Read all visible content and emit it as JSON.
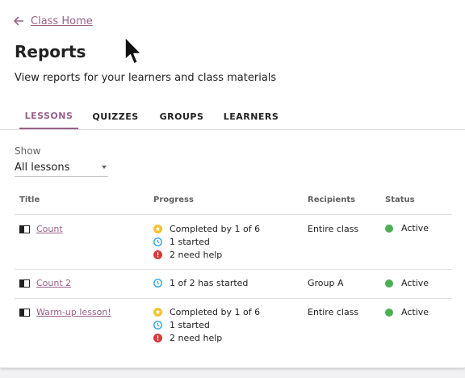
{
  "nav": {
    "back_label": "Class Home"
  },
  "header": {
    "title": "Reports",
    "subtitle": "View reports for your learners and class materials"
  },
  "tabs": [
    {
      "label": "LESSONS",
      "active": true
    },
    {
      "label": "QUIZZES",
      "active": false
    },
    {
      "label": "GROUPS",
      "active": false
    },
    {
      "label": "LEARNERS",
      "active": false
    }
  ],
  "filter": {
    "label": "Show",
    "selected": "All lessons"
  },
  "table": {
    "columns": [
      "Title",
      "Progress",
      "Recipients",
      "Status"
    ],
    "rows": [
      {
        "title": "Count",
        "progress": [
          {
            "icon": "star-icon",
            "text": "Completed by 1 of 6"
          },
          {
            "icon": "clock-icon",
            "text": "1 started"
          },
          {
            "icon": "help-icon",
            "text": "2 need help"
          }
        ],
        "recipients": "Entire class",
        "status": "Active"
      },
      {
        "title": "Count 2",
        "progress": [
          {
            "icon": "clock-icon",
            "text": "1 of 2 has started"
          }
        ],
        "recipients": "Group A",
        "status": "Active"
      },
      {
        "title": "Warm-up lesson!",
        "progress": [
          {
            "icon": "star-icon",
            "text": "Completed by 1 of 6"
          },
          {
            "icon": "clock-icon",
            "text": "1 started"
          },
          {
            "icon": "help-icon",
            "text": "2 need help"
          }
        ],
        "recipients": "Entire class",
        "status": "Active"
      }
    ]
  },
  "colors": {
    "accent": "#996189",
    "completed": "#f2c232",
    "started": "#2ea4e8",
    "help": "#d63838",
    "active": "#4caf50"
  }
}
